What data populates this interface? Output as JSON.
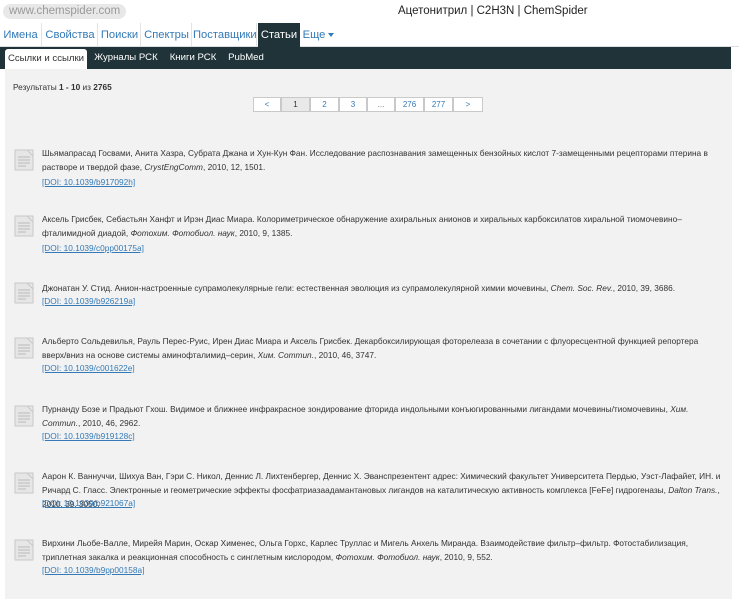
{
  "header": {
    "logo": "www.chemspider.com",
    "title": "Ацетонитрил | C2H3N | ChemSpider"
  },
  "nav": {
    "items": [
      "Имена",
      "Свойства",
      "Поиски",
      "Спектры",
      "Поставщики",
      "Статьи",
      "Еще"
    ],
    "active": "Статьи"
  },
  "subnav": {
    "items": [
      "Ссылки и ссылки",
      "Журналы РСК",
      "Книги РСК",
      "PubMed"
    ]
  },
  "results": {
    "prefix": "Результаты ",
    "range": "1 - 10",
    "of": " из ",
    "total": "2765"
  },
  "pager": [
    "<",
    "1",
    "2",
    "3",
    "...",
    "276",
    "277",
    ">"
  ],
  "articles": [
    {
      "text": "Шьямапрасад Госвами, Анита Хазра, Субрата Джана и Хун-Кун Фан. Исследование распознавания замещенных бензойных кислот 7-замещенными рецепторами птерина в растворе и твердой фазе, ",
      "journal": "CrystEngComm",
      "details": ", 2010, 12, 1501.",
      "doi": "[DOI: 10.1039/b917092h]"
    },
    {
      "text": "Аксель Грисбек, Себастьян Ханфт и Ирэн Диас Миара. Колориметрическое обнаружение ахиральных анионов и хиральных карбоксилатов хиральной тиомочевино–фталимидной диадой, ",
      "journal": "Фотохим. Фотобиол. наук",
      "details": ", 2010, 9, 1385.",
      "doi": "[DOI: 10.1039/c0pp00175a]"
    },
    {
      "text": "Джонатан У. Стид. Анион-настроенные супрамолекулярные гели: естественная эволюция из супрамолекулярной химии мочевины, ",
      "journal": "Chem. Soc. Rev.",
      "details": ", 2010, 39, 3686.",
      "doi": "[DOI: 10.1039/b926219a]"
    },
    {
      "text": "Альберто Сольдевилья, Рауль Перес-Руис, Ирен Диас Миара и Аксель Грисбек. Декарбоксилирующая фоторелеаза в сочетании с флуоресцентной функцией репортера вверх/вниз на основе системы аминофталимид–серин, ",
      "journal": "Хим. Commun.",
      "details": ", 2010, 46, 3747.",
      "doi": "[DOI: 10.1039/c001622e]"
    },
    {
      "text": "Пурнанду Бозе и Прадьют Гхош. Видимое и ближнее инфракрасное зондирование фторида индольными конъюгированными лигандами мочевины/тиомочевины, ",
      "journal": "Хим. Commun.",
      "details": ", 2010, 46, 2962.",
      "doi": "[DOI: 10.1039/b919128c]"
    },
    {
      "text": "Аарон К. Ваннуччи, Шихуа Ван, Гэри С. Никол, Деннис Л. Лихтенбергер, Деннис Х. Эванспрезентент адрес: Химический факультет Университета Пердью, Уэст-Лафайет, ИН. и Ричард С. Гласс. Электронные и геометрические эффекты фосфатриазаадамантановых лигандов на каталитическую активность комплекса [FeFe] гидрогеназы, ",
      "journal": "Dalton Trans.",
      "details": ", 2010, 39, 3050.",
      "doi": "[DOI: 10.1039/b921067a]"
    },
    {
      "text": "Вирхини Льобе-Валле, Мирейя Марин, Оскар Хименес, Ольга Горхс, Карлес Труллас и Мигель Анхель Миранда. Взаимодействие фильтр–фильтр. Фотостабилизация, триплетная закалка и реакционная способность с синглетным кислородом, ",
      "journal": "Фотохим. Фотобиол. наук",
      "details": ", 2010, 9, 552.",
      "doi": "[DOI: 10.1039/b9pp00158a]"
    }
  ],
  "colors": {
    "accent": "#337ab7",
    "dark_bar": "#1f3338",
    "panel": "#f2f2f2"
  },
  "icons": {
    "article": "document-icon",
    "dropdown": "caret-down-icon"
  }
}
